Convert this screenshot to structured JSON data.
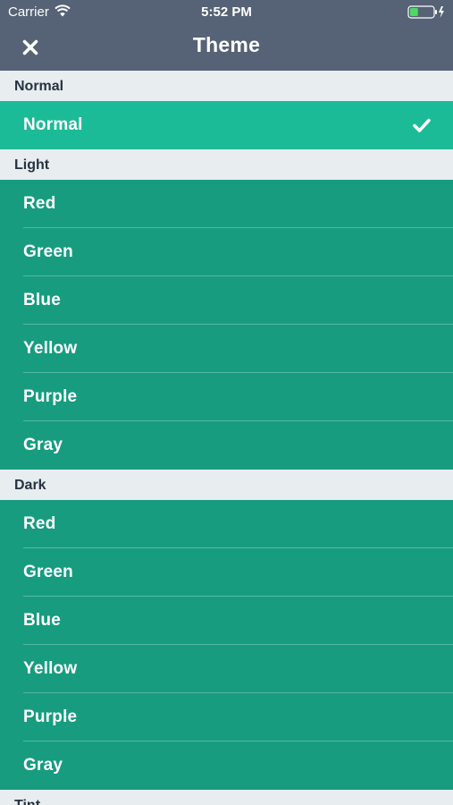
{
  "status_bar": {
    "carrier": "Carrier",
    "time": "5:52 PM",
    "battery_level": 0.35,
    "battery_color": "#4cd964"
  },
  "nav": {
    "title": "Theme",
    "close_icon": "close-icon"
  },
  "colors": {
    "nav_background": "#566275",
    "section_background": "#e8edf0",
    "row_background": "#179c80",
    "selected_row_background": "#1cbb98"
  },
  "sections": [
    {
      "header": "Normal",
      "items": [
        {
          "label": "Normal",
          "selected": true
        }
      ]
    },
    {
      "header": "Light",
      "items": [
        {
          "label": "Red",
          "selected": false
        },
        {
          "label": "Green",
          "selected": false
        },
        {
          "label": "Blue",
          "selected": false
        },
        {
          "label": "Yellow",
          "selected": false
        },
        {
          "label": "Purple",
          "selected": false
        },
        {
          "label": "Gray",
          "selected": false
        }
      ]
    },
    {
      "header": "Dark",
      "items": [
        {
          "label": "Red",
          "selected": false
        },
        {
          "label": "Green",
          "selected": false
        },
        {
          "label": "Blue",
          "selected": false
        },
        {
          "label": "Yellow",
          "selected": false
        },
        {
          "label": "Purple",
          "selected": false
        },
        {
          "label": "Gray",
          "selected": false
        }
      ]
    },
    {
      "header": "Tint",
      "items": []
    }
  ]
}
